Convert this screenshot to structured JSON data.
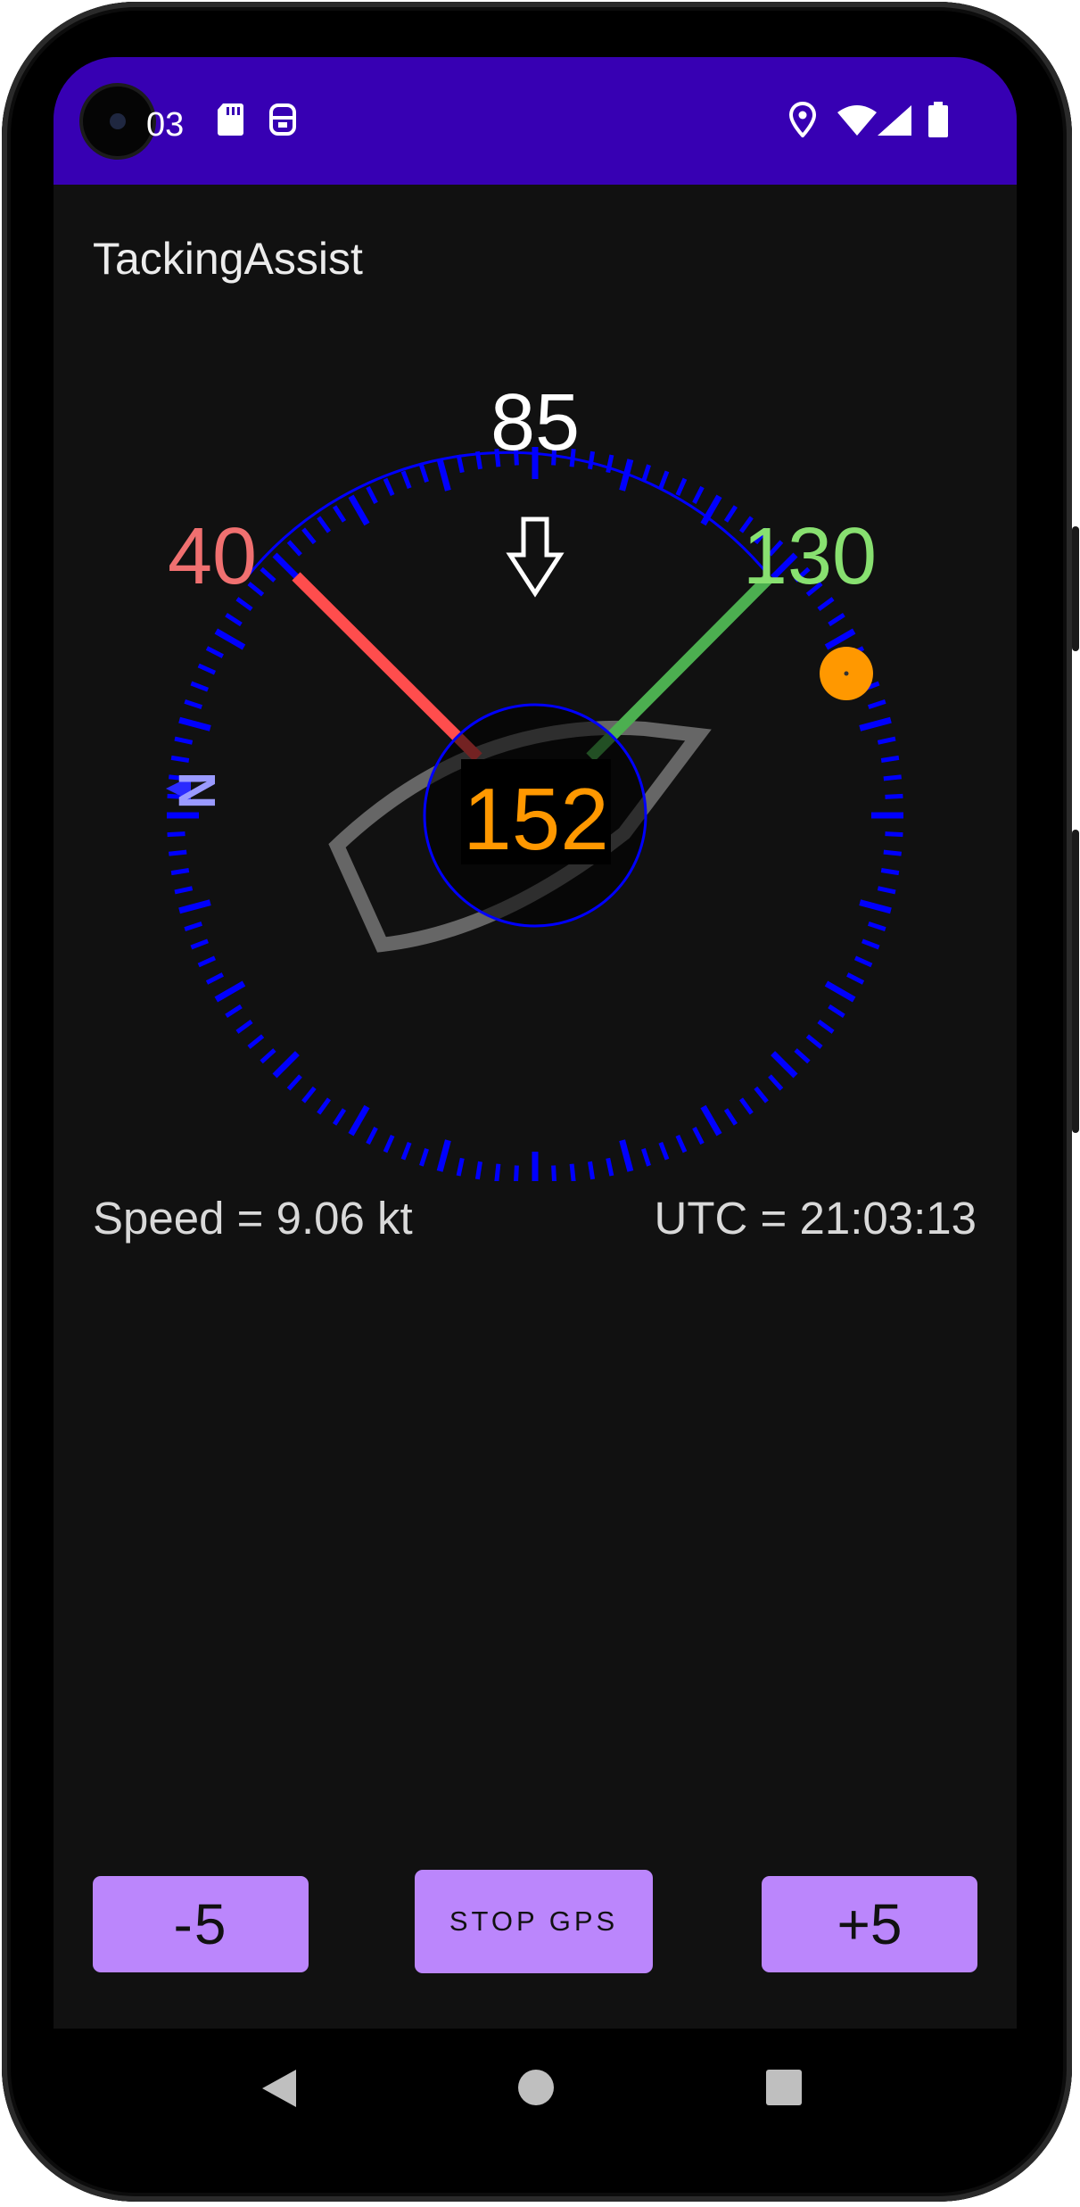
{
  "status_bar": {
    "time": "03",
    "icons": [
      "sd-card-icon",
      "accessibility-icon",
      "location-icon",
      "wifi-icon",
      "signal-icon",
      "battery-icon"
    ]
  },
  "app": {
    "title": "TackingAssist"
  },
  "compass": {
    "top_angle": "85",
    "port_angle": "40",
    "starboard_angle": "130",
    "center_heading": "152",
    "north_label": "N"
  },
  "readouts": {
    "speed": "Speed = 9.06 kt",
    "utc": "UTC = 21:03:13"
  },
  "buttons": {
    "minus": "-5",
    "stop_gps": "STOP GPS",
    "plus": "+5"
  },
  "colors": {
    "status_bar": "#3700b3",
    "compass_ticks": "#0000ff",
    "port": "#ff4d4d",
    "port_label": "#f07070",
    "starboard": "#4caf50",
    "starboard_label": "#88e070",
    "heading": "#ff9800",
    "button": "#bb86fc"
  },
  "nav_bar": {
    "icons": [
      "back-icon",
      "home-icon",
      "recents-icon"
    ]
  }
}
